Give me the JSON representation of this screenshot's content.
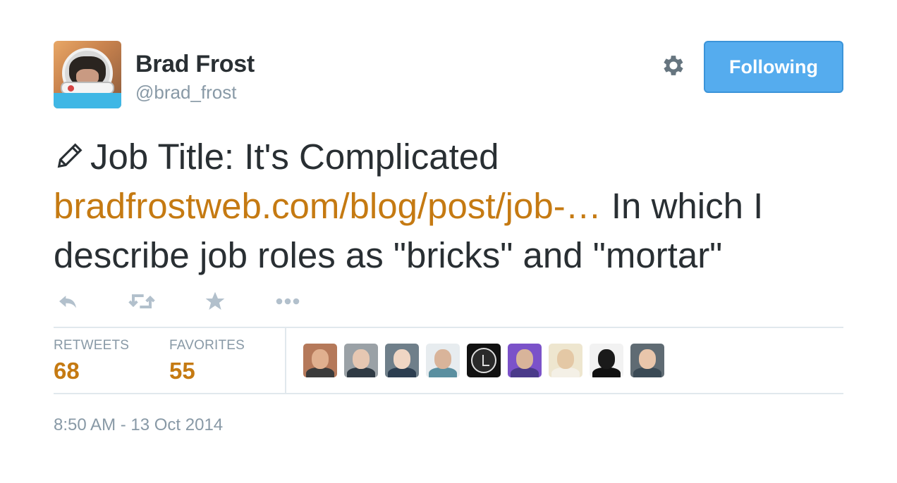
{
  "author": {
    "name": "Brad Frost",
    "handle": "@brad_frost"
  },
  "follow_button": {
    "label": "Following"
  },
  "tweet": {
    "prefix_icon": "pencil-icon",
    "text_line1": "Job Title: It's Complicated",
    "link_text": "bradfrostweb.com/blog/post/job-…",
    "text_after_link": " In which I describe job roles as \"bricks\" and \"mortar\""
  },
  "actions": [
    {
      "name": "reply",
      "icon": "reply-icon"
    },
    {
      "name": "retweet",
      "icon": "retweet-icon"
    },
    {
      "name": "favorite",
      "icon": "star-icon"
    },
    {
      "name": "more",
      "icon": "more-icon"
    }
  ],
  "stats": {
    "retweets_label": "RETWEETS",
    "retweets_count": "68",
    "favorites_label": "FAVORITES",
    "favorites_count": "55"
  },
  "favoriters": [
    {
      "bg": "#b5795a",
      "head": "#e0b08f",
      "body": "#3b3b3b"
    },
    {
      "bg": "#9aa1a6",
      "head": "#e6c7b2",
      "body": "#2f3a44"
    },
    {
      "bg": "#6f7f8a",
      "head": "#f0d6c4",
      "body": "#2c3e50"
    },
    {
      "bg": "#e7ecef",
      "head": "#d9b49a",
      "body": "#5a8fa0"
    },
    {
      "bg": "#111111",
      "head": "#111111",
      "body": "#111111"
    },
    {
      "bg": "#7b52c9",
      "head": "#d8b49a",
      "body": "#4a3a8a"
    },
    {
      "bg": "#eee6cf",
      "head": "#e4c8a5",
      "body": "#f4f0e6"
    },
    {
      "bg": "#f2f2f2",
      "head": "#1a1a1a",
      "body": "#111111"
    },
    {
      "bg": "#5f6b73",
      "head": "#e9c6ab",
      "body": "#3a4a55"
    }
  ],
  "timestamp": "8:50 AM - 13 Oct 2014",
  "colors": {
    "link": "#c57a12",
    "button": "#55acee",
    "muted": "#8899a6",
    "text": "#292f33"
  }
}
